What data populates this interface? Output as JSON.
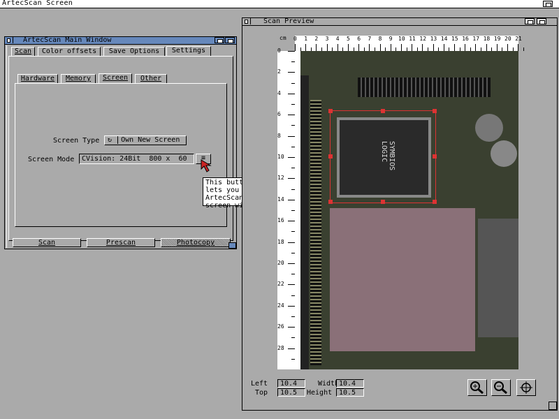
{
  "screen": {
    "title": "ArtecScan Screen"
  },
  "main_window": {
    "title": "ArtecScan Main Window",
    "tabs": [
      "Scan",
      "Color offsets",
      "Save Options",
      "Settings"
    ],
    "subtabs": [
      "Hardware",
      "Memory",
      "Screen",
      "Other"
    ],
    "screen_type_label": "Screen Type",
    "screen_type_value": "Own New Screen",
    "screen_mode_label": "Screen Mode",
    "screen_mode_value": "CVision: 24Bit  800 x  60",
    "tooltip": "This button opens a requester which\nlets you specify the Screen Mode,\nArtecScan shall use to open its\nscreen with.",
    "bottom_buttons": [
      "Scan",
      "Prescan",
      "Photocopy"
    ]
  },
  "preview_window": {
    "title": "Scan Preview",
    "ruler_unit": "cm",
    "top_ticks": [
      "0",
      "1",
      "2",
      "3",
      "4",
      "5",
      "6",
      "7",
      "8",
      "9",
      "10",
      "11",
      "12",
      "13",
      "14",
      "15",
      "16",
      "17",
      "18",
      "19",
      "20",
      "21"
    ],
    "left_ticks": [
      "0",
      "2",
      "4",
      "6",
      "8",
      "10",
      "12",
      "14",
      "16",
      "18",
      "20",
      "22",
      "24",
      "26",
      "28"
    ],
    "chip_text": [
      "SYMBIOS",
      "LOGIC"
    ],
    "fields": {
      "left_label": "Left",
      "left_value": "10.4",
      "top_label": "Top",
      "top_value": "10.5",
      "width_label": "Width",
      "width_value": "10.4",
      "height_label": "Height",
      "height_value": "10.5"
    },
    "icons": [
      "zoom-in-icon",
      "zoom-out-icon",
      "crosshair-icon"
    ]
  }
}
